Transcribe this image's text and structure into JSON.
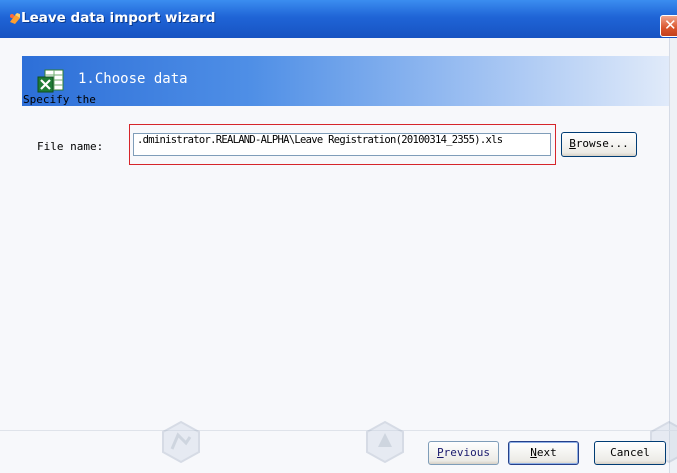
{
  "window": {
    "title": "Leave data import wizard",
    "close_glyph": "✕"
  },
  "step": {
    "title": "1.Choose data",
    "icon": "excel-icon"
  },
  "instruction": "Specify the",
  "file": {
    "label": "File name:",
    "value": ".dministrator.REALAND-ALPHA\\Leave Registration(20100314_2355).xls"
  },
  "buttons": {
    "browse": {
      "mnemonic": "B",
      "rest": "rowse..."
    },
    "previous": {
      "mnemonic": "P",
      "rest": "revious"
    },
    "next": {
      "mnemonic": "N",
      "rest": "ext"
    },
    "cancel": "Cancel"
  },
  "colors": {
    "title_bar": "#1f64d6",
    "step_band": "#2d6fd8",
    "highlight_border": "#d6252a"
  }
}
